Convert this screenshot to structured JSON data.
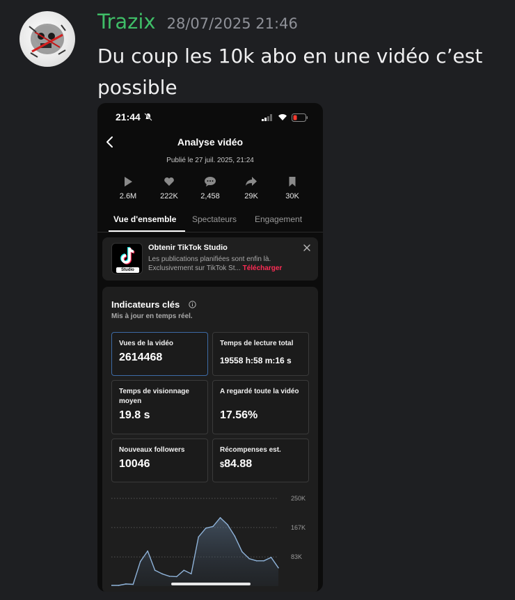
{
  "message": {
    "author": "Trazix",
    "author_color": "#3fbd67",
    "timestamp": "28/07/2025 21:46",
    "text": "Du coup les 10k abo en une vidéo c’est possible"
  },
  "phone": {
    "status_time": "21:44",
    "title": "Analyse vidéo",
    "published": "Publié le 27 juil. 2025, 21:24",
    "stats": [
      {
        "icon": "play-icon",
        "value": "2.6M"
      },
      {
        "icon": "heart-icon",
        "value": "222K"
      },
      {
        "icon": "comment-icon",
        "value": "2,458"
      },
      {
        "icon": "share-icon",
        "value": "29K"
      },
      {
        "icon": "bookmark-icon",
        "value": "30K"
      }
    ],
    "tabs": [
      "Vue d'ensemble",
      "Spectateurs",
      "Engagement"
    ],
    "promo": {
      "title": "Obtenir TikTok Studio",
      "line1": "Les publications planifiées sont enfin là.",
      "line2": "Exclusivement sur TikTok St...",
      "link": "Télécharger",
      "logo_tag": "Studio"
    },
    "key_indicators": {
      "title": "Indicateurs clés",
      "subtitle": "Mis à jour en temps réel.",
      "metrics": [
        {
          "label": "Vues de la vidéo",
          "value": "2614468"
        },
        {
          "label": "Temps de lecture total",
          "value": "19558 h:58 m:16 s"
        },
        {
          "label": "Temps de visionnage moyen",
          "value": "19.8 s"
        },
        {
          "label": "A regardé toute la vidéo",
          "value": "17.56%"
        },
        {
          "label": "Nouveaux followers",
          "value": "10046"
        },
        {
          "label": "Récompenses est.",
          "currency": "$",
          "value": "84.88"
        }
      ]
    },
    "accent_link_color": "#fe2c55"
  },
  "chart_data": {
    "type": "area",
    "x": [
      0,
      1,
      2,
      3,
      4,
      5,
      6,
      7,
      8,
      9,
      10,
      11,
      12,
      13,
      14,
      15,
      16,
      17,
      18,
      19,
      20,
      21,
      22,
      23
    ],
    "values": [
      2,
      2,
      6,
      5,
      70,
      100,
      45,
      35,
      28,
      27,
      45,
      35,
      140,
      165,
      170,
      195,
      175,
      142,
      98,
      78,
      72,
      72,
      82,
      52
    ],
    "yticks": [
      "250K",
      "167K",
      "83K"
    ],
    "y_scale": "thousands",
    "ylim": [
      0,
      250
    ],
    "grid": true,
    "line_color": "#8fb3d9"
  }
}
